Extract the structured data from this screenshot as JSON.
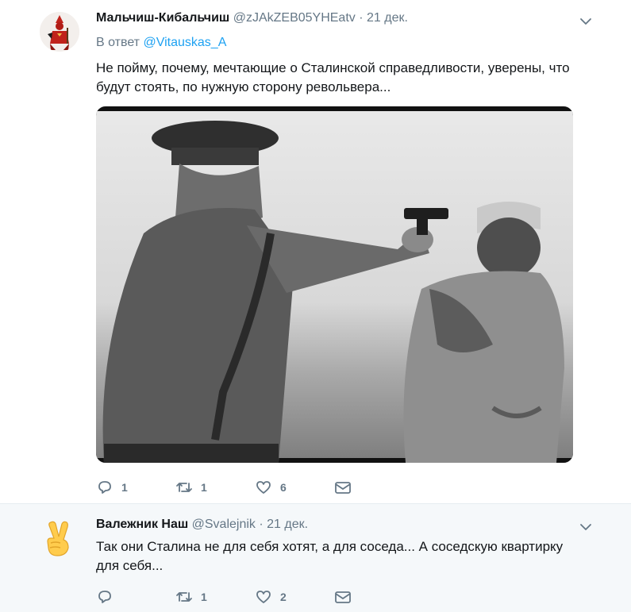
{
  "tweets": [
    {
      "name": "Мальчиш-Кибальчиш",
      "handle": "@zJAkZEB05YHEatv",
      "separator": "·",
      "date": "21 дек.",
      "reply_prefix": "В ответ",
      "reply_to": "@Vitauskas_A",
      "text": "Не пойму, почему, мечтающие о Сталинской справедливости, уверены, что будут стоять, по нужную сторону револьвера...",
      "replies": "1",
      "retweets": "1",
      "likes": "6",
      "avatar_icon": "red-soldier-icon"
    },
    {
      "name": "Валежник Наш",
      "handle": "@Svalejnik",
      "separator": "·",
      "date": "21 дек.",
      "text": "Так они Сталина не для себя хотят, а для соседа... А соседскую квартирку для себя...",
      "replies": "",
      "retweets": "1",
      "likes": "2",
      "avatar_icon": "victory-hand-icon"
    }
  ],
  "colors": {
    "accent": "#1da1f2",
    "thread_line": "#c4e0f5",
    "secondary_text": "#657786",
    "reply_bg": "#f5f8fa"
  }
}
